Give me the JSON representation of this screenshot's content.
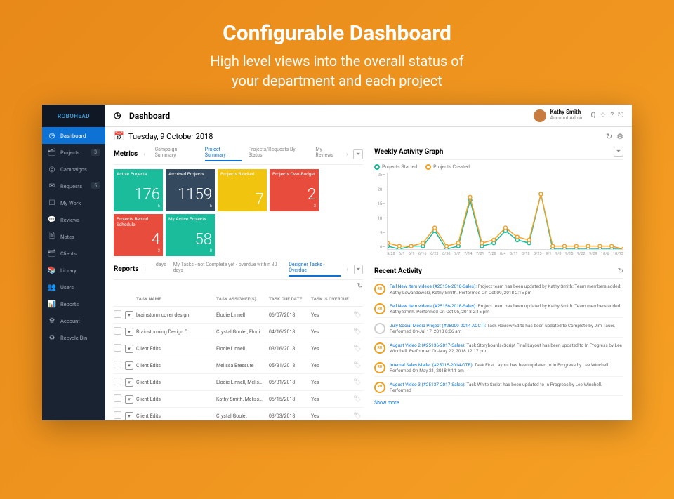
{
  "hero": {
    "title": "Configurable Dashboard",
    "subtitle": "High level views into the overall status of\nyour department and each project"
  },
  "logo": "ROBOHEAD",
  "nav": [
    {
      "icon": "◷",
      "label": "Dashboard",
      "active": true
    },
    {
      "icon": "🗂",
      "label": "Projects",
      "badge": "3"
    },
    {
      "icon": "◎",
      "label": "Campaigns"
    },
    {
      "icon": "✉",
      "label": "Requests",
      "badge": "5"
    },
    {
      "icon": "☐",
      "label": "My Work"
    },
    {
      "icon": "💬",
      "label": "Reviews"
    },
    {
      "icon": "🗎",
      "label": "Notes"
    },
    {
      "icon": "🗂",
      "label": "Clients"
    },
    {
      "icon": "📚",
      "label": "Library"
    },
    {
      "icon": "👥",
      "label": "Users"
    },
    {
      "icon": "📊",
      "label": "Reports"
    },
    {
      "icon": "⚙",
      "label": "Account"
    },
    {
      "icon": "♻",
      "label": "Recycle Bin"
    }
  ],
  "header": {
    "title": "Dashboard",
    "user_name": "Kathy Smith",
    "user_role": "Account Admin",
    "icons": [
      "Q",
      "☆",
      "?",
      "⎋"
    ]
  },
  "date": "Tuesday, 9 October 2018",
  "metrics": {
    "section": "Metrics",
    "tabs": [
      "Campaign Summary",
      "Project Summary",
      "Projects/Requests By Status",
      "My Reviews"
    ],
    "active_tab": "Project Summary",
    "cards": [
      {
        "label": "Active Projects",
        "value": "176",
        "sub": "5",
        "color": "c-teal"
      },
      {
        "label": "Archived Projects",
        "value": "1159",
        "sub": "5",
        "color": "c-dark"
      },
      {
        "label": "Projects Blocked",
        "value": "7",
        "sub": "",
        "color": "c-ylw"
      },
      {
        "label": "Projects Over-Budget",
        "value": "2",
        "sub": "3",
        "color": "c-red"
      },
      {
        "label": "Projects Behind Schedule",
        "value": "4",
        "sub": "3",
        "color": "c-red"
      },
      {
        "label": "My Active Projects",
        "value": "58",
        "sub": "0",
        "color": "c-teal"
      }
    ]
  },
  "reports": {
    "section": "Reports",
    "tabs": [
      "days",
      "My Tasks - not Complete yet - overdue within 30 days",
      "Designer Tasks - Overdue"
    ],
    "active_tab": "Designer Tasks - Overdue",
    "columns": [
      "TASK NAME",
      "TASK ASSIGNEE(S)",
      "TASK DUE DATE",
      "TASK IS OVERDUE"
    ],
    "rows": [
      {
        "name": "brainstorm cover design",
        "assignee": "Elodie Linnell",
        "due": "06/07/2018",
        "overdue": "Yes"
      },
      {
        "name": "Brainstorming Design C",
        "assignee": "Crystal Goulet, Elodi…",
        "due": "04/16/2018",
        "overdue": "Yes"
      },
      {
        "name": "Client Edits",
        "assignee": "Elodie Linnell",
        "due": "03/16/2018",
        "overdue": "Yes"
      },
      {
        "name": "Client Edits",
        "assignee": "Melissa Bressure",
        "due": "05/31/2018",
        "overdue": "Yes"
      },
      {
        "name": "Client Edits",
        "assignee": "Elodie Linnell, Melis…",
        "due": "05/31/2018",
        "overdue": "Yes"
      },
      {
        "name": "Client Edits",
        "assignee": "Kathy Smith, Meliss…",
        "due": "05/15/2018",
        "overdue": "Yes"
      },
      {
        "name": "Client Edits",
        "assignee": "Crystal Goulet",
        "due": "03/03/2018",
        "overdue": "Yes"
      }
    ]
  },
  "activity_graph": {
    "section": "Weekly Activity Graph",
    "legend": [
      "Projects Started",
      "Projects Created"
    ]
  },
  "chart_data": {
    "type": "line",
    "ylim": [
      0,
      25
    ],
    "yticks": [
      0,
      5,
      10,
      15,
      20,
      25
    ],
    "x": [
      "5/28",
      "6/1",
      "6/9",
      "6/16",
      "6/23",
      "6/30",
      "7/7",
      "7/14",
      "7/21",
      "7/28",
      "8/4",
      "8/11",
      "8/18",
      "8/25",
      "9/1",
      "9/8",
      "9/15",
      "9/22",
      "9/29",
      "10/6",
      "10/13"
    ],
    "series": [
      {
        "name": "Projects Started",
        "color": "#1abc9c",
        "values": [
          1,
          0,
          1,
          1,
          6,
          0,
          1,
          16,
          1,
          2,
          6,
          3,
          2,
          18,
          0,
          0,
          0,
          0,
          0,
          0,
          0
        ]
      },
      {
        "name": "Projects Created",
        "color": "#f6a024",
        "values": [
          2,
          1,
          1,
          2,
          7,
          1,
          2,
          17,
          2,
          3,
          7,
          4,
          3,
          18,
          1,
          1,
          1,
          1,
          1,
          1,
          0
        ]
      }
    ]
  },
  "recent": {
    "section": "Recent Activity",
    "items": [
      {
        "avatar": "RH",
        "link": "Fall New Item videos (#25156-2018-Sales):",
        "text": " Project team has been updated by Kathy Smith: Team members added: Kathy Lewandowski, Kathy Smith.  Performed On-Oct 09, 2018 2:15 pm"
      },
      {
        "avatar": "RH",
        "link": "Fall New Item videos (#25156-2018-Sales):",
        "text": " Project team has been updated by Kathy Smith: Team members added: Kathy Smith.  Performed On-Oct 05, 2018 2:15 pm"
      },
      {
        "avatar": "",
        "gray": true,
        "link": "July Social Media Project (#25009-2014-ACCT):",
        "text": " Task Review/Edits has been updated to Complete by Jim Tauer.  Performed On-Jul 17, 2018 8:06 am"
      },
      {
        "avatar": "RH",
        "link": "August Video 2 (#25136-2017-Sales):",
        "text": " Task Storyboards/Script Final Layout has been updated to In Progress by Lee Winchell.  Performed On-May 22, 2018 12:17 pm"
      },
      {
        "avatar": "RH",
        "link": "Internal Sales Mailer (#25015-2014-OTR):",
        "text": " Task First Layout has been updated to In Progress by Lee Winchell.  Performed On-May 21, 2018 9:11 am"
      },
      {
        "avatar": "RH",
        "link": "August Video 3 (#25137-2017-Sales):",
        "text": " Task White Script has been updated to In Progress by Lee Winchell.  Performed"
      }
    ],
    "show_more": "Show more"
  }
}
